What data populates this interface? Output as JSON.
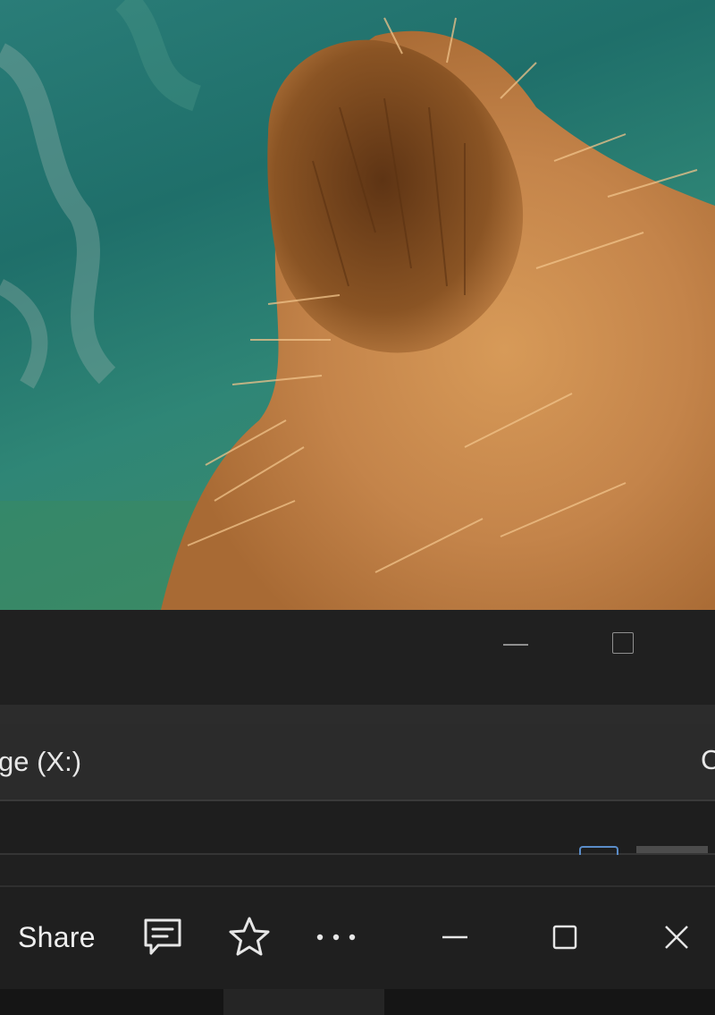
{
  "wallpaper": {
    "colors": {
      "water": "#2a7d78",
      "fur_light": "#d9a060",
      "fur_dark": "#6b3d18"
    }
  },
  "back_window": {
    "controls": [
      "minimize-icon",
      "maximize-icon"
    ],
    "address_text": "ge (X:)",
    "address_edge_glyph": "C"
  },
  "front_window": {
    "toolbar": {
      "share_label": "Share",
      "icons": [
        "comment-icon",
        "star-icon",
        "more-icon",
        "minimize-icon",
        "maximize-icon",
        "close-icon"
      ]
    }
  },
  "colors": {
    "titlebar": "#202020",
    "toolbar": "#1f1f1f",
    "address_bar": "#2b2b2b",
    "text": "#e8e8e8"
  }
}
